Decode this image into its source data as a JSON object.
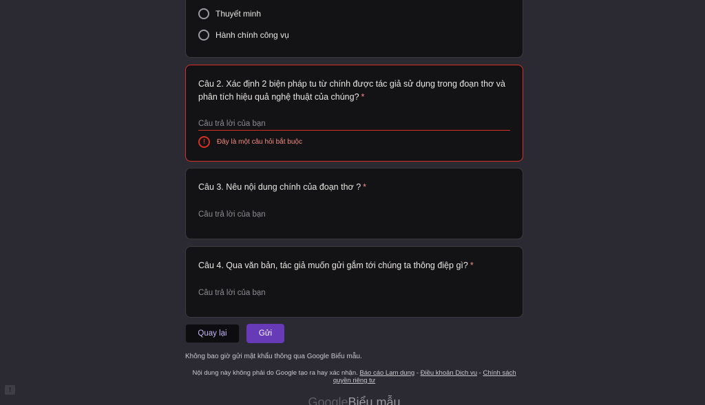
{
  "q1": {
    "options": [
      "Thuyết minh",
      "Hành chính công vụ"
    ]
  },
  "q2": {
    "title": "Câu 2. Xác định 2 biện pháp tu từ chính được tác giả sử dụng trong đoạn thơ và phân tích hiệu quả nghệ thuật của chúng?",
    "required": "*",
    "placeholder": "Câu trả lời của bạn",
    "error": "Đây là một câu hỏi bắt buộc",
    "error_icon": "!"
  },
  "q3": {
    "title": "Câu 3. Nêu nội dung chính của đoạn thơ ?",
    "required": "*",
    "placeholder": "Câu trả lời của bạn"
  },
  "q4": {
    "title": "Câu 4. Qua văn bản, tác giả muốn gửi gắm tới chúng ta thông điệp gì?",
    "required": "*",
    "placeholder": "Câu trả lời của bạn"
  },
  "buttons": {
    "back": "Quay lại",
    "submit": "Gửi"
  },
  "note": "Không bao giờ gửi mật khẩu thông qua Google Biểu mẫu.",
  "footer": {
    "text": "Nội dung này không phải do Google tạo ra hay xác nhận.",
    "sep": "-",
    "report_abuse": "Báo cáo Lạm dụng",
    "terms": "Điều khoản Dịch vụ",
    "privacy": "Chính sách quyền riêng tư"
  },
  "brand": {
    "google": "Google",
    "forms": "Biểu mẫu"
  },
  "report_icon": "!",
  "colors": {
    "background": "#2b2a33",
    "card": "#131315",
    "error": "#d93025",
    "accent": "#673ab7"
  }
}
